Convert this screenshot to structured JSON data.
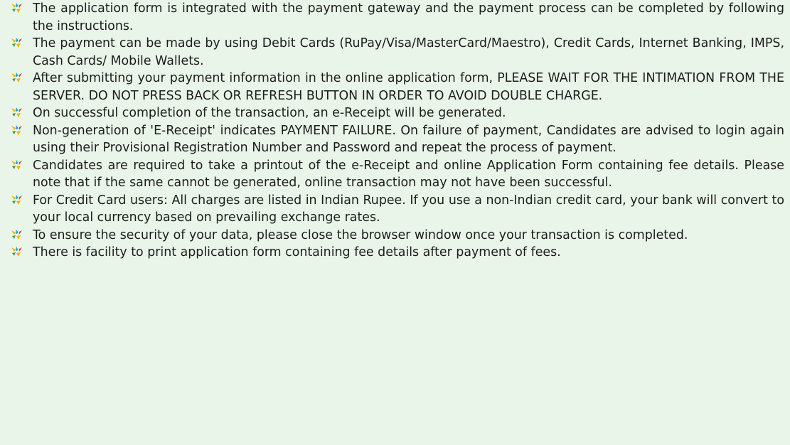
{
  "bullet_icon": "colorful-sparkle-bullet-icon",
  "colors": {
    "background": "#e9f5e9",
    "text": "#1d1d1d"
  },
  "instructions": [
    "The application form is integrated with the payment gateway and the payment process can be completed by following the instructions.",
    "The payment can be made by using Debit Cards (RuPay/Visa/MasterCard/Maestro), Credit Cards, Internet Banking, IMPS, Cash Cards/ Mobile Wallets.",
    "After submitting your payment information in the online application form, PLEASE WAIT FOR THE INTIMATION FROM THE SERVER. DO NOT PRESS BACK OR REFRESH BUTTON IN ORDER TO AVOID DOUBLE CHARGE.",
    "On successful completion of the transaction, an e-Receipt will be generated.",
    "Non-generation of 'E-Receipt' indicates PAYMENT FAILURE. On failure of payment, Candidates are advised to login again using their Provisional Registration Number and Password and repeat the process of payment.",
    "Candidates are required to take a printout of the e-Receipt and online Application Form containing fee details. Please note that if the same cannot be generated, online transaction may not have been successful.",
    "For Credit Card users: All charges are listed in Indian Rupee. If you use a non-Indian credit card, your bank will convert to your local currency based on prevailing exchange rates.",
    "To ensure the security of your data, please close the browser window once your transaction is completed.",
    "There is facility to print application form containing fee details after payment of fees."
  ]
}
